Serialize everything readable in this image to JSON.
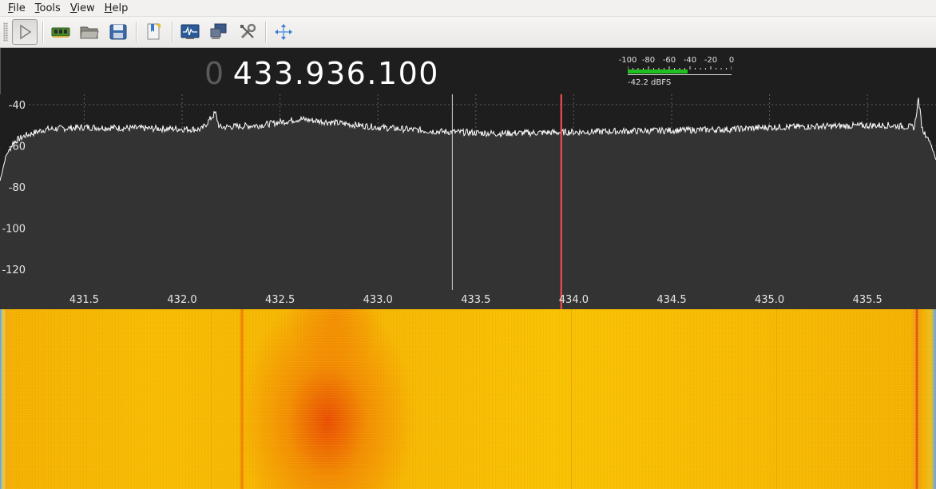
{
  "menu": {
    "items": [
      {
        "mnemonic": "F",
        "rest": "ile"
      },
      {
        "mnemonic": "T",
        "rest": "ools"
      },
      {
        "mnemonic": "V",
        "rest": "iew"
      },
      {
        "mnemonic": "H",
        "rest": "elp"
      }
    ]
  },
  "toolbar": {
    "buttons": [
      "play-icon",
      "sdr-device-icon",
      "open-folder-icon",
      "save-icon",
      "bookmark-icon",
      "fft-settings-icon",
      "remote-control-icon",
      "configure-icon",
      "fit-view-icon"
    ]
  },
  "frequency": {
    "leading": "0",
    "value": "433.936.100"
  },
  "meter": {
    "scale": [
      "-100",
      "-80",
      "-60",
      "-40",
      "-20",
      "0"
    ],
    "level_dbfs": -42.2,
    "readout": "-42.2 dBFS"
  },
  "colors": {
    "trace": "#ffffff",
    "filter_marker": "#ff5050",
    "meter_fill": "#20c020",
    "plot_bg": "#333333"
  },
  "chart_data": {
    "type": "line",
    "ylim": [
      -130,
      -35
    ],
    "xlim": [
      431.07,
      435.85
    ],
    "y_ticks": [
      -40,
      -60,
      -80,
      -100,
      -120
    ],
    "x_ticks": [
      "431.5",
      "432.0",
      "432.5",
      "433.0",
      "433.5",
      "434.0",
      "434.5",
      "435.0",
      "435.5"
    ],
    "grid": true,
    "markers": {
      "filter_left": 433.38,
      "center": 433.936
    },
    "spectrum": [
      {
        "x": 431.07,
        "y": -77
      },
      {
        "x": 431.1,
        "y": -65
      },
      {
        "x": 431.14,
        "y": -58
      },
      {
        "x": 431.2,
        "y": -55
      },
      {
        "x": 431.3,
        "y": -52
      },
      {
        "x": 431.5,
        "y": -51
      },
      {
        "x": 431.8,
        "y": -51.5
      },
      {
        "x": 432.1,
        "y": -52
      },
      {
        "x": 432.17,
        "y": -44
      },
      {
        "x": 432.19,
        "y": -51
      },
      {
        "x": 432.4,
        "y": -50
      },
      {
        "x": 432.6,
        "y": -47
      },
      {
        "x": 432.8,
        "y": -49
      },
      {
        "x": 433.0,
        "y": -51
      },
      {
        "x": 433.3,
        "y": -53
      },
      {
        "x": 433.6,
        "y": -54
      },
      {
        "x": 433.9,
        "y": -53.5
      },
      {
        "x": 434.2,
        "y": -53
      },
      {
        "x": 434.5,
        "y": -52.5
      },
      {
        "x": 434.8,
        "y": -52
      },
      {
        "x": 435.0,
        "y": -51
      },
      {
        "x": 435.3,
        "y": -50.5
      },
      {
        "x": 435.6,
        "y": -50
      },
      {
        "x": 435.74,
        "y": -51
      },
      {
        "x": 435.76,
        "y": -37
      },
      {
        "x": 435.78,
        "y": -52
      },
      {
        "x": 435.82,
        "y": -58
      },
      {
        "x": 435.85,
        "y": -67
      }
    ]
  }
}
